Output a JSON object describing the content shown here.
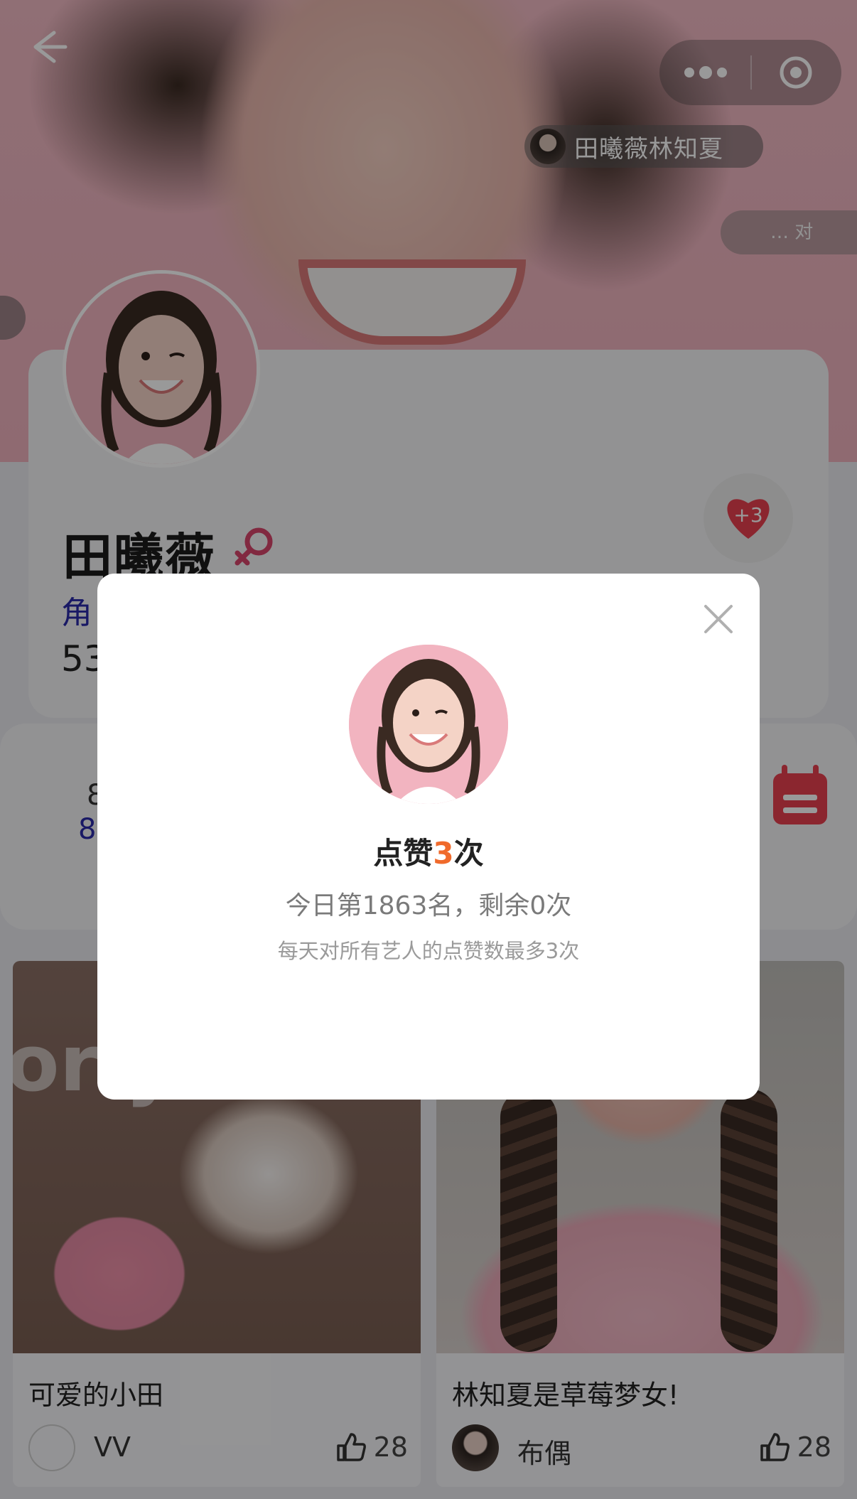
{
  "header": {
    "user_chip_name": "田曦薇林知夏",
    "right_chip_text": "… 对"
  },
  "profile": {
    "name": "田曦薇",
    "role_fragment": "角",
    "number_fragment": "53",
    "like_plus": "+3"
  },
  "stats": {
    "line1": "8",
    "line2": "8"
  },
  "posts": [
    {
      "title": "可爱的小田",
      "author": "VV",
      "likes": "28",
      "overlay_text": "or y"
    },
    {
      "title": "林知夏是草莓梦女!",
      "author": "布偶",
      "likes": "28"
    }
  ],
  "modal": {
    "count_prefix": "点赞",
    "count_number": "3",
    "count_suffix": "次",
    "rank_text": "今日第1863名，剩余0次",
    "hint_text": "每天对所有艺人的点赞数最多3次"
  },
  "colors": {
    "accent": "#f06a2b",
    "heart": "#e8404f",
    "link_blue": "#2a2aa8"
  }
}
